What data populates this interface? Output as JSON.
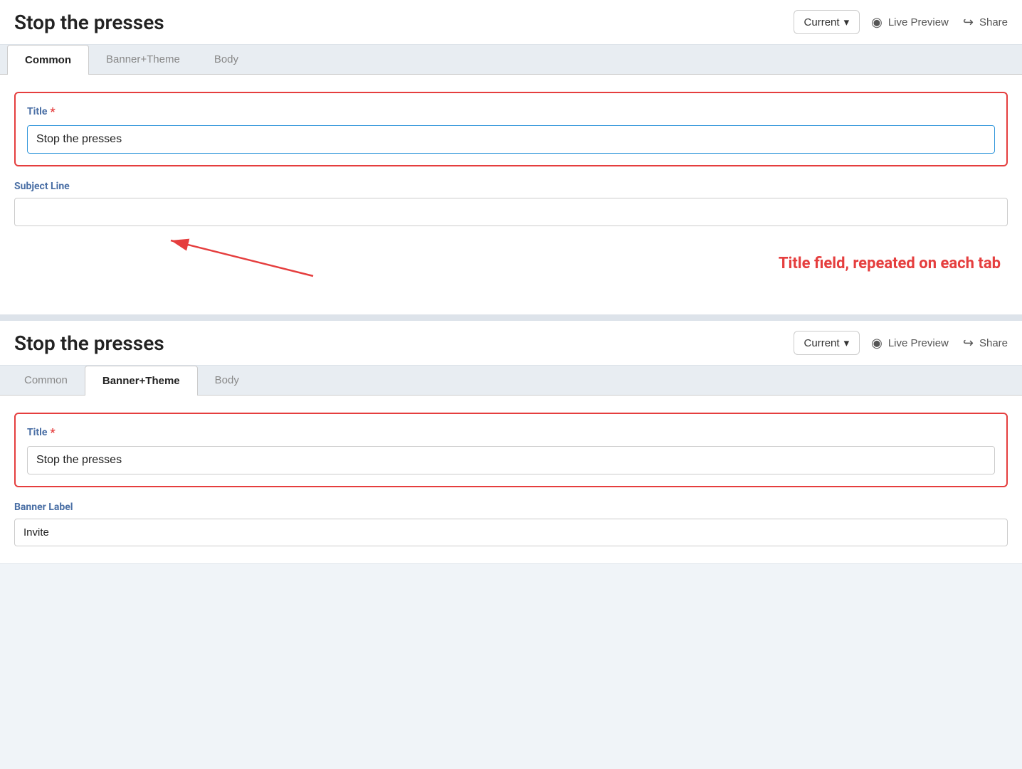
{
  "page": {
    "title": "Stop the presses",
    "version_label": "Current",
    "version_chevron": "▾",
    "live_preview_label": "Live Preview",
    "share_label": "Share"
  },
  "section1": {
    "tabs": [
      {
        "id": "common",
        "label": "Common",
        "active": true
      },
      {
        "id": "banner-theme",
        "label": "Banner+Theme",
        "active": false
      },
      {
        "id": "body",
        "label": "Body",
        "active": false
      }
    ],
    "title_field_label": "Title",
    "title_field_value": "Stop the presses",
    "title_placeholder": "",
    "subject_line_label": "Subject Line",
    "subject_line_value": "",
    "subject_placeholder": ""
  },
  "annotation": {
    "text": "Title field, repeated on each tab"
  },
  "section2": {
    "tabs": [
      {
        "id": "common",
        "label": "Common",
        "active": false
      },
      {
        "id": "banner-theme",
        "label": "Banner+Theme",
        "active": true
      },
      {
        "id": "body",
        "label": "Body",
        "active": false
      }
    ],
    "title_field_label": "Title",
    "title_field_value": "Stop the presses",
    "banner_label_label": "Banner Label",
    "banner_label_value": "Invite"
  },
  "icons": {
    "eye": "◉",
    "share": "↪",
    "chevron_down": "▾"
  }
}
